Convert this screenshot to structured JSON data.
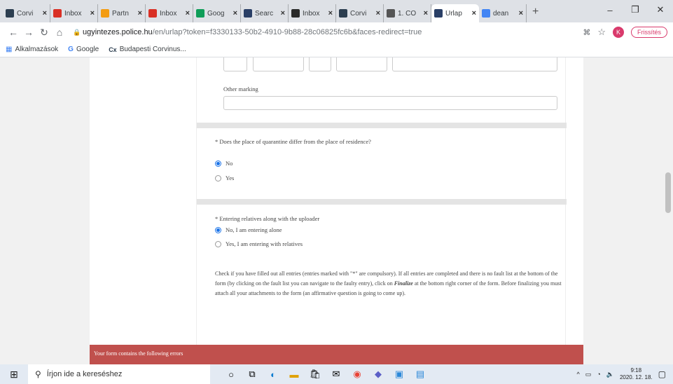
{
  "browser": {
    "tabs": [
      {
        "label": "Corvi",
        "icon": "corvinus-icon",
        "color": "#2c3e50",
        "active": false
      },
      {
        "label": "Inbox",
        "icon": "gmail-icon",
        "color": "#d93025",
        "active": false
      },
      {
        "label": "Partn",
        "icon": "partner-icon",
        "color": "#f39c12",
        "active": false
      },
      {
        "label": "Inbox",
        "icon": "gmail-icon",
        "color": "#d93025",
        "active": false
      },
      {
        "label": "Goog",
        "icon": "google-sheets-icon",
        "color": "#0f9d58",
        "active": false
      },
      {
        "label": "Searc",
        "icon": "forms-icon",
        "color": "#2a3f66",
        "active": false
      },
      {
        "label": "Inbox",
        "icon": "mail-icon",
        "color": "#2a2a2a",
        "active": false
      },
      {
        "label": "Corvi",
        "icon": "corvinus-icon",
        "color": "#2c3e50",
        "active": false
      },
      {
        "label": "1. CO",
        "icon": "globe-icon",
        "color": "#555555",
        "active": false
      },
      {
        "label": "Úrlap",
        "icon": "forms-icon",
        "color": "#2a3f66",
        "active": true
      },
      {
        "label": "dean",
        "icon": "google-icon",
        "color": "#4285f4",
        "active": false
      }
    ],
    "url_host": "ugyintezes.police.hu",
    "url_rest": "/en/urlap?token=f3330133-50b2-4910-9b88-28c06825fc6b&faces-redirect=true",
    "refresh_label": "Frissítés",
    "avatar_letter": "K",
    "bookmarks": [
      {
        "label": "Alkalmazások",
        "icon": "apps-grid-icon"
      },
      {
        "label": "Google",
        "icon": "google-icon"
      },
      {
        "label": "Budapesti Corvinus...",
        "icon": "corvinus-icon"
      }
    ]
  },
  "form": {
    "other_marking_label": "Other marking",
    "q1_label": "* Does the place of quarantine differ from the place of residence?",
    "q1_options": [
      "No",
      "Yes"
    ],
    "q1_selected": 0,
    "q2_label": "* Entering relatives along with the uploader",
    "q2_options": [
      "No, I am entering alone",
      "Yes, I am entering with relatives"
    ],
    "q2_selected": 0,
    "instructions_1": "Check if you have filled out all entries (entries marked with \"*\" are compulsory). If all entries are completed and there is no fault list at the bottom of the form (by clicking on the fault list you can navigate to the faulty entry), click on ",
    "instructions_bold": "Finalize",
    "instructions_2": " at the bottom right corner of the form. Before finalizing you must attach all your attachments to the form (an affirmative question is going to come up).",
    "error_banner": "Your form contains the following errors"
  },
  "taskbar": {
    "search_placeholder": "Írjon ide a kereséshez",
    "time": "9:18",
    "date": "2020. 12. 18."
  }
}
